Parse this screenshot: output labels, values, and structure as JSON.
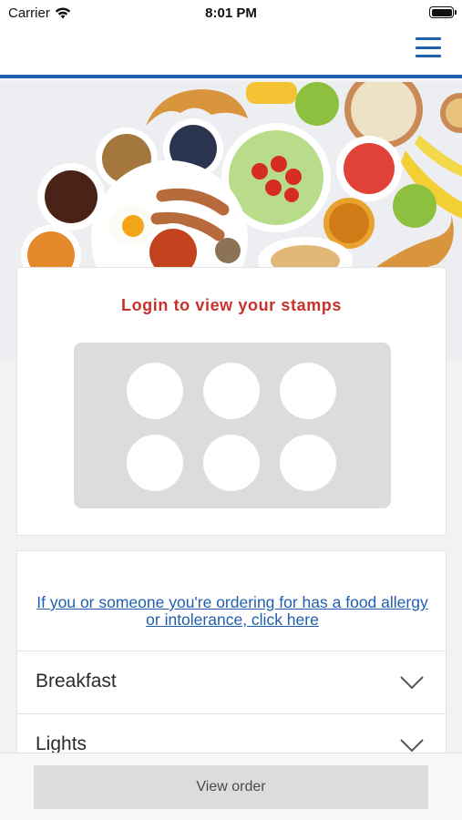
{
  "status_bar": {
    "carrier": "Carrier",
    "time": "8:01 PM"
  },
  "nav": {
    "menu_icon": "hamburger-icon",
    "accent": "#1f5fae"
  },
  "hero": {
    "image": "breakfast-spread-photo"
  },
  "stamps": {
    "title": "Login to view your stamps",
    "title_color": "#c8322a",
    "stamp_count": 6,
    "collected": 0
  },
  "menu": {
    "allergy_text": "If you or someone you're ordering for has a food allergy or intolerance, click here",
    "categories": [
      {
        "label": "Breakfast",
        "icon": "chevron-down-icon"
      },
      {
        "label": "Lights",
        "icon": "chevron-down-icon"
      }
    ]
  },
  "footer": {
    "view_order_label": "View order"
  }
}
